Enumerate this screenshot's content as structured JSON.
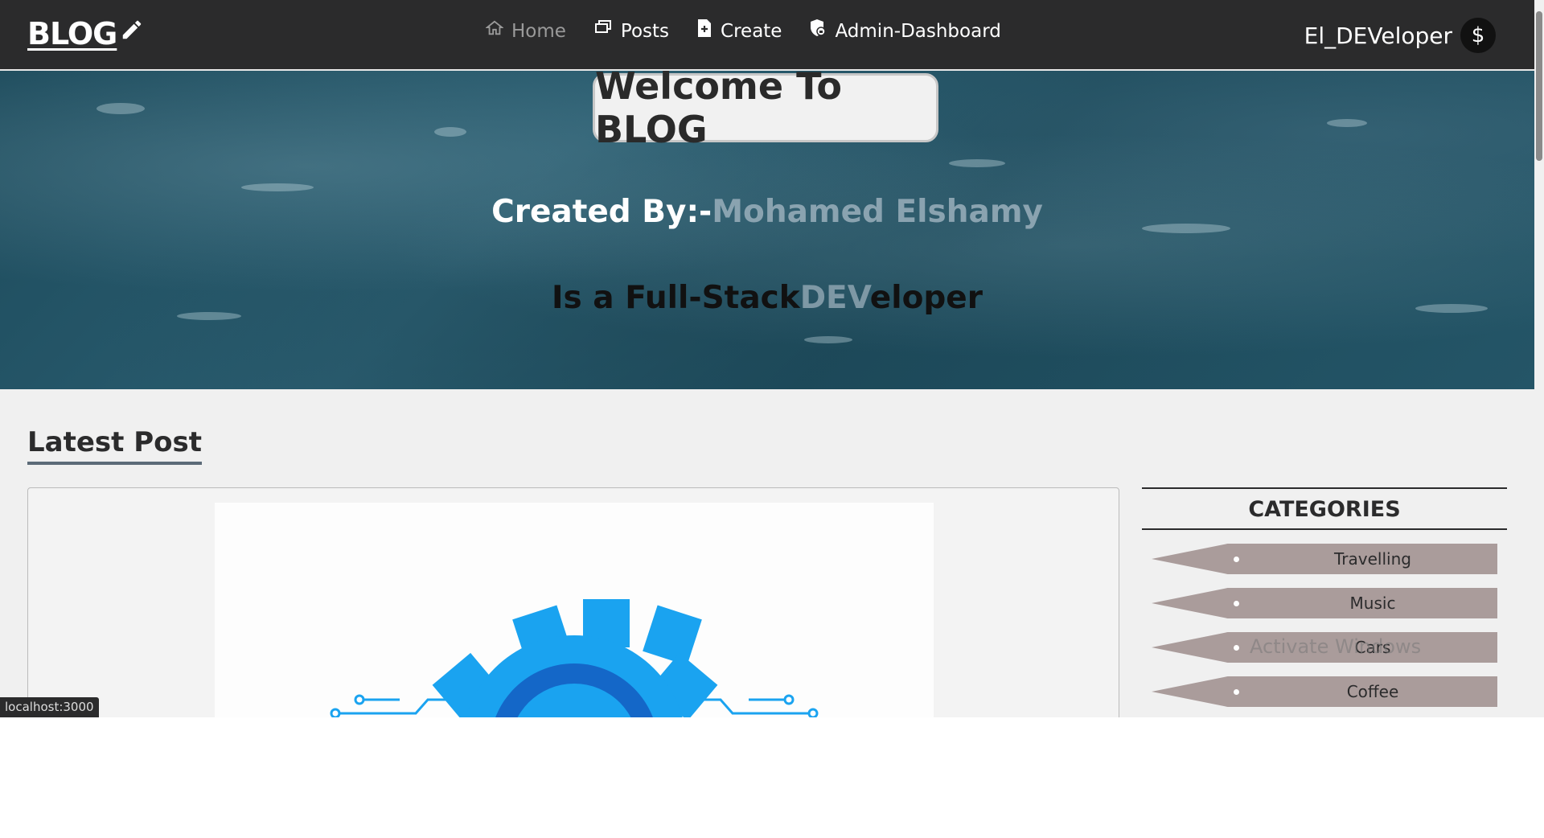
{
  "navbar": {
    "brand": "BLOG",
    "links": [
      {
        "label": "Home",
        "icon": "home-icon",
        "active": true
      },
      {
        "label": "Posts",
        "icon": "posts-icon"
      },
      {
        "label": "Create",
        "icon": "file-plus-icon"
      },
      {
        "label": "Admin-Dashboard",
        "icon": "shield-lock-icon"
      }
    ],
    "username": "El_DEVeloper",
    "avatar_glyph": "$"
  },
  "hero": {
    "welcome": "Welcome To BLOG",
    "created_prefix": "Created By:-",
    "created_name": "Mohamed Elshamy",
    "role_prefix": "Is a Full-Stack",
    "role_highlight": "DEV",
    "role_suffix": "eloper"
  },
  "main": {
    "section_title": "Latest Post"
  },
  "sidebar": {
    "title": "CATEGORIES",
    "categories": [
      "Travelling",
      "Music",
      "Cars",
      "Coffee"
    ]
  },
  "overlay": {
    "watermark": "Activate Windows",
    "status_url": "localhost:3000"
  },
  "colors": {
    "navbar_bg": "#2b2b2c",
    "category_bar": "#aa9c9b",
    "hero_name": "#8aa3b0",
    "gear_blue": "#1aa3f0"
  }
}
